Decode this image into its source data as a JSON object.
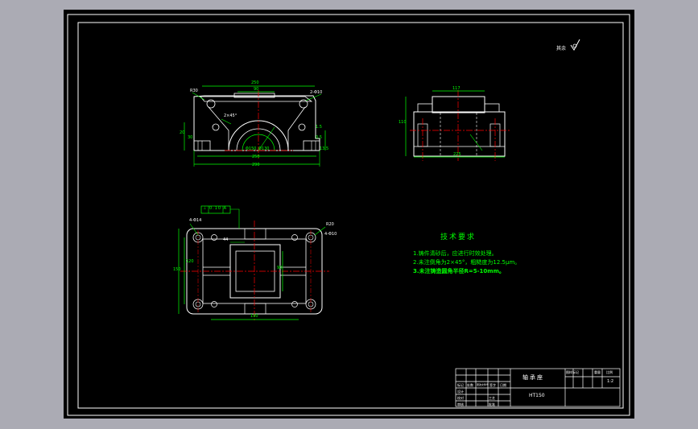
{
  "colors": {
    "background": "#000000",
    "frame": "#ffffff",
    "outline": "#ffffff",
    "dimension": "#00ff00",
    "centerline": "#ff0000",
    "text": "#ffffff",
    "note_text": "#00ff00",
    "title_text": "#ffff00",
    "margin": "#ababb4"
  },
  "surface_mark": {
    "label": "其余",
    "symbol": "roughness-check-icon"
  },
  "front_view": {
    "top_width": "250",
    "inner_width": "90",
    "bore": "Φ150",
    "bore_small": "Φ130",
    "overall_width": "250",
    "base_width": "290",
    "bolt_holes": "2-Φ10",
    "radius": "R30",
    "height_left": "20",
    "height_side": "30",
    "angle": "2×45°",
    "chamfer": "1.5",
    "small_dim": "0.5",
    "step": "13.5"
  },
  "side_view": {
    "top_width": "117",
    "height": "110",
    "base_width": "225"
  },
  "top_view": {
    "tolerance_frame": "⊥ 0.10 A",
    "holes_left": "4-Φ14",
    "holes_right": "4-Φ10",
    "radius": "R20",
    "inner_dim": "44",
    "height": "150",
    "height_inner": "120",
    "pocket": "90",
    "length": "190"
  },
  "technical_requirements": {
    "title": "技术要求",
    "items": [
      "1.铸件清砂后，应进行时效处理。",
      "2.未注倒角为2×45°，粗糙度为12.5μm。",
      "3.未注铸造圆角半径R=5-10mm。"
    ]
  },
  "title_block": {
    "part_name": "轴承座",
    "material": "HT150",
    "scale": "1:2",
    "header_labels": [
      "图样标记",
      "重量",
      "比例"
    ],
    "row_labels": [
      "标记",
      "处数",
      "更改文件号",
      "签字",
      "日期",
      "设计",
      "校对",
      "审核",
      "工艺",
      "批准"
    ]
  }
}
